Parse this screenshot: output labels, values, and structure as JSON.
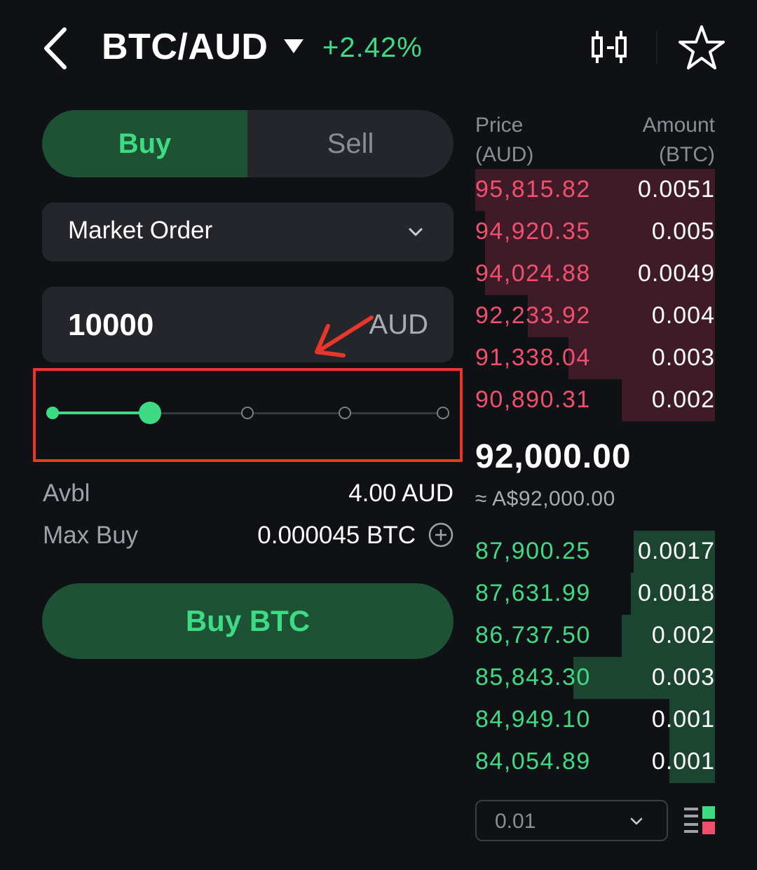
{
  "header": {
    "pair": "BTC/AUD",
    "change": "+2.42%",
    "icons": [
      "back-icon",
      "caret-down-icon",
      "chart-icon",
      "star-icon"
    ]
  },
  "trade": {
    "tabs": {
      "buy": "Buy",
      "sell": "Sell",
      "selected": "Buy"
    },
    "order_type": "Market Order",
    "amount": {
      "value": "10000",
      "unit": "AUD"
    },
    "slider": {
      "percent": 25,
      "steps": [
        0,
        25,
        50,
        75,
        100
      ]
    },
    "avbl_label": "Avbl",
    "avbl_value": "4.00 AUD",
    "maxbuy_label": "Max Buy",
    "maxbuy_value": "0.000045 BTC",
    "submit_label": "Buy BTC"
  },
  "orderbook": {
    "price_header_1": "Price",
    "price_header_2": "(AUD)",
    "amount_header_1": "Amount",
    "amount_header_2": "(BTC)",
    "asks": [
      {
        "price": "95,815.82",
        "amount": "0.0051",
        "depth": 1.0
      },
      {
        "price": "94,920.35",
        "amount": "0.005",
        "depth": 0.96
      },
      {
        "price": "94,024.88",
        "amount": "0.0049",
        "depth": 0.96
      },
      {
        "price": "92,233.92",
        "amount": "0.004",
        "depth": 0.78
      },
      {
        "price": "91,338.04",
        "amount": "0.003",
        "depth": 0.61
      },
      {
        "price": "90,890.31",
        "amount": "0.002",
        "depth": 0.39
      }
    ],
    "last_price": "92,000.00",
    "last_fiat": "≈ A$92,000.00",
    "bids": [
      {
        "price": "87,900.25",
        "amount": "0.0017",
        "depth": 0.34
      },
      {
        "price": "87,631.99",
        "amount": "0.0018",
        "depth": 0.35
      },
      {
        "price": "86,737.50",
        "amount": "0.002",
        "depth": 0.39
      },
      {
        "price": "85,843.30",
        "amount": "0.003",
        "depth": 0.59
      },
      {
        "price": "84,949.10",
        "amount": "0.001",
        "depth": 0.19
      },
      {
        "price": "84,054.89",
        "amount": "0.001",
        "depth": 0.19
      }
    ],
    "precision": "0.01"
  },
  "colors": {
    "background": "#0f1115",
    "accent_green": "#3ddc84",
    "ask_red": "#f0506e",
    "annotation_red": "#e8362b"
  }
}
